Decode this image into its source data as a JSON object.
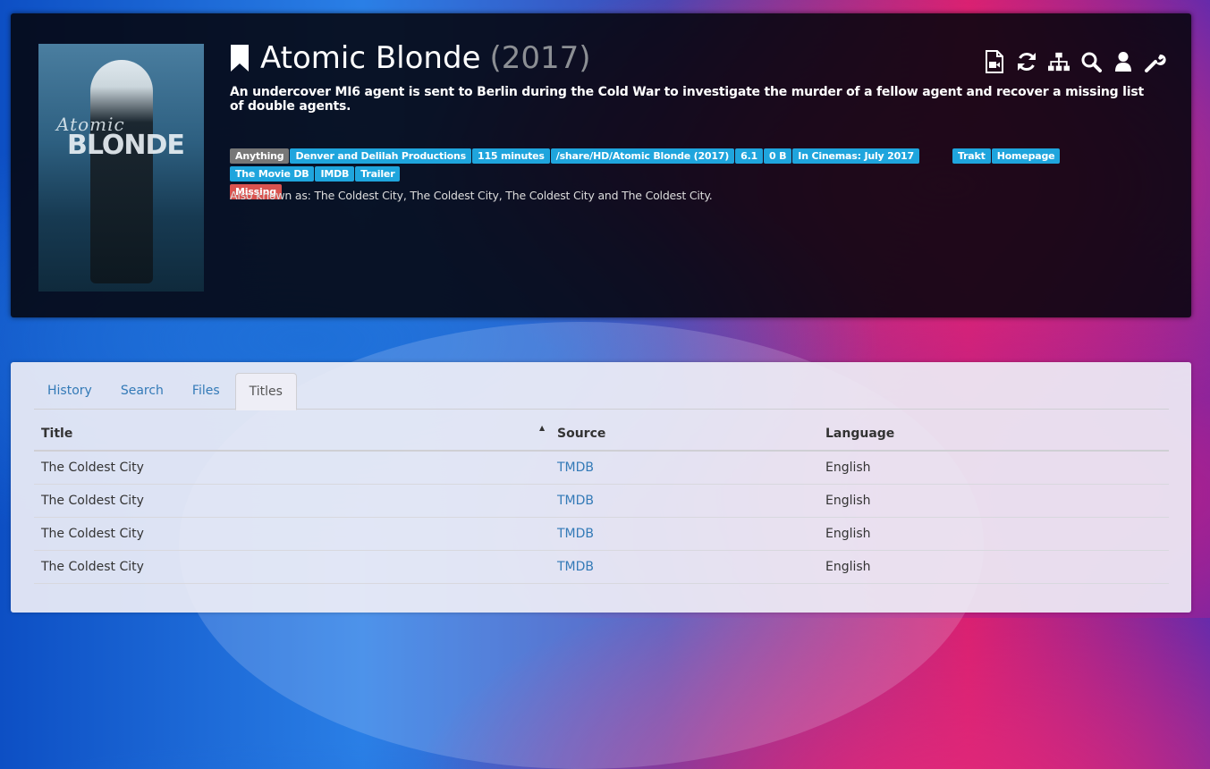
{
  "movie": {
    "title": "Atomic Blonde",
    "year": "(2017)",
    "overview": "An undercover MI6 agent is sent to Berlin during the Cold War to investigate the murder of a fellow agent and recover a missing list of double agents.",
    "poster_text_1": "Atomic",
    "poster_text_2": "BLONDE",
    "also_known_as": "Also known as: The Coldest City, The Coldest City, The Coldest City and The Coldest City."
  },
  "toolbar": {
    "icons": [
      "file-video-icon",
      "refresh-icon",
      "sitemap-icon",
      "search-icon",
      "user-icon",
      "wrench-icon"
    ]
  },
  "labels": {
    "profile": "Anything",
    "studio": "Denver and Delilah Productions",
    "runtime": "115 minutes",
    "path": "/share/HD/Atomic Blonde (2017)",
    "rating": "6.1",
    "size": "0 B",
    "in_cinemas": "In Cinemas: July 2017",
    "trakt": "Trakt",
    "homepage": "Homepage",
    "tmdb": "The Movie DB",
    "imdb": "IMDB",
    "trailer": "Trailer",
    "status": "Missing"
  },
  "tabs": [
    {
      "label": "History"
    },
    {
      "label": "Search"
    },
    {
      "label": "Files"
    },
    {
      "label": "Titles"
    }
  ],
  "active_tab": "Titles",
  "table": {
    "headers": {
      "title": "Title",
      "source": "Source",
      "language": "Language"
    },
    "rows": [
      {
        "title": "The Coldest City",
        "source": "TMDB",
        "language": "English"
      },
      {
        "title": "The Coldest City",
        "source": "TMDB",
        "language": "English"
      },
      {
        "title": "The Coldest City",
        "source": "TMDB",
        "language": "English"
      },
      {
        "title": "The Coldest City",
        "source": "TMDB",
        "language": "English"
      }
    ]
  },
  "colors": {
    "label_default": "#777777",
    "label_info": "#1fa5dd",
    "label_danger": "#d9534f",
    "link": "#337ab7"
  }
}
